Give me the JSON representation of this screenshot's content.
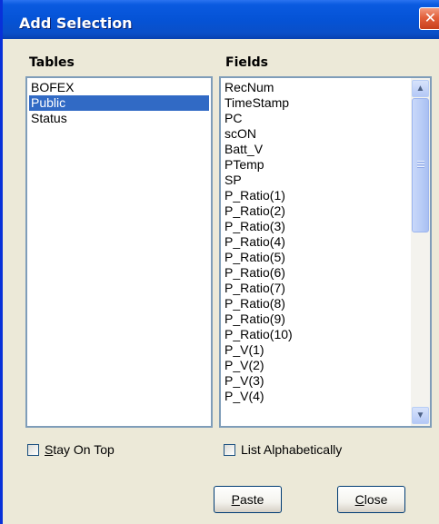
{
  "window": {
    "title": "Add Selection",
    "close_glyph": "✕"
  },
  "tables": {
    "header": "Tables",
    "items": [
      "BOFEX",
      "Public",
      "Status"
    ],
    "selected": "Public"
  },
  "fields": {
    "header": "Fields",
    "items": [
      "RecNum",
      "TimeStamp",
      "PC",
      "scON",
      "Batt_V",
      "PTemp",
      "SP",
      "P_Ratio(1)",
      "P_Ratio(2)",
      "P_Ratio(3)",
      "P_Ratio(4)",
      "P_Ratio(5)",
      "P_Ratio(6)",
      "P_Ratio(7)",
      "P_Ratio(8)",
      "P_Ratio(9)",
      "P_Ratio(10)",
      "P_V(1)",
      "P_V(2)",
      "P_V(3)",
      "P_V(4)"
    ],
    "scroll_up_icon": "scroll-up-arrow",
    "scroll_down_icon": "scroll-down-arrow"
  },
  "options": {
    "stay_on_top": {
      "mnemonic": "S",
      "rest": "tay On Top",
      "checked": false
    },
    "list_alphabetically": {
      "label": "List Alphabetically",
      "checked": false
    }
  },
  "buttons": {
    "paste": {
      "mnemonic": "P",
      "rest": "aste"
    },
    "close": {
      "mnemonic": "C",
      "rest": "lose"
    }
  },
  "colors": {
    "titlebar": "#0553d6",
    "selection": "#316ac5",
    "dialog_bg": "#ece9d8",
    "close_button": "#e2603b"
  }
}
